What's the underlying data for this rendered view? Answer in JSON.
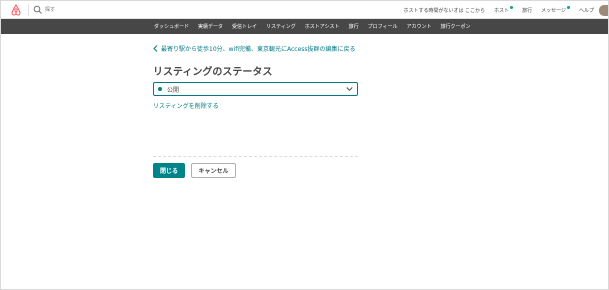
{
  "header": {
    "search_placeholder": "探す",
    "links": [
      {
        "label": "ホストする時間がないオは ここから",
        "dot": false
      },
      {
        "label": "ホスト",
        "dot": true
      },
      {
        "label": "旅行",
        "dot": false
      },
      {
        "label": "メッセージ",
        "dot": true
      },
      {
        "label": "ヘルプ",
        "dot": false
      }
    ]
  },
  "nav": {
    "items": [
      "ダッシュボード",
      "実績データ",
      "受信トレイ",
      "リスティング",
      "ホストアシスト",
      "旅行",
      "プロフィール",
      "アカウント",
      "旅行クーポン"
    ]
  },
  "main": {
    "back_link": "最寄り駅から徒歩10分、wifi完備、東京観光にAccess抜群の編集に戻る",
    "title": "リスティングのステータス",
    "status_select": {
      "value": "公開"
    },
    "delete_link": "リスティングを削除する",
    "close_button": "閉じる",
    "cancel_button": "キャンセル"
  },
  "colors": {
    "brand": "#ff5a5f",
    "accent": "#008489",
    "nav_bg": "#474747"
  },
  "icons": {
    "logo": "airbnb-logo-icon",
    "search": "search-icon",
    "back": "chevron-left-icon",
    "dropdown": "chevron-down-icon"
  }
}
